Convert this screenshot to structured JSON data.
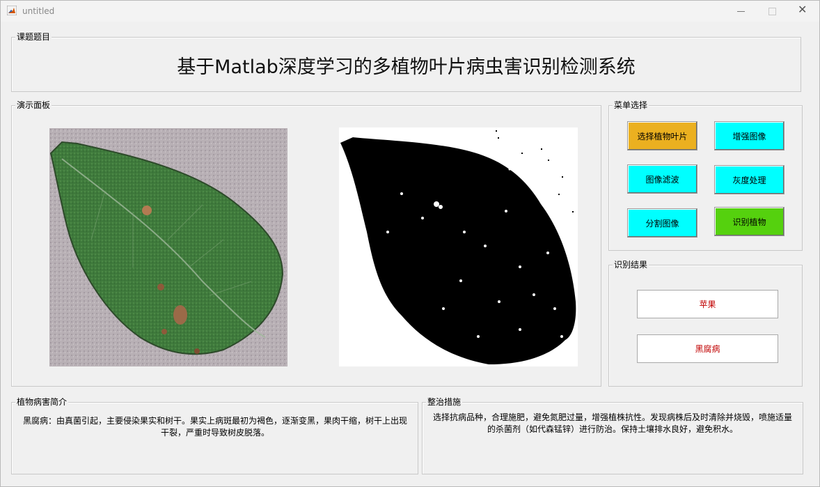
{
  "window": {
    "title": "untitled",
    "close_glyph": "✕"
  },
  "title_panel": {
    "label": "课题题目",
    "title": "基于Matlab深度学习的多植物叶片病虫害识别检测系统"
  },
  "demo_panel": {
    "label": "演示面板"
  },
  "menu_panel": {
    "label": "菜单选择",
    "buttons": [
      {
        "label": "选择植物叶片",
        "color": "#ebb020"
      },
      {
        "label": "增强图像",
        "color": "#00ffff"
      },
      {
        "label": "图像滤波",
        "color": "#00ffff"
      },
      {
        "label": "灰度处理",
        "color": "#00ffff"
      },
      {
        "label": "分割图像",
        "color": "#00ffff"
      },
      {
        "label": "识别植物",
        "color": "#55d10e"
      }
    ]
  },
  "result_panel": {
    "label": "识别结果",
    "plant": "苹果",
    "disease": "黑腐病",
    "text_color": "#c00000"
  },
  "intro_panel": {
    "label": "植物病害简介",
    "text": "黑腐病：由真菌引起，主要侵染果实和树干。果实上病斑最初为褐色，逐渐变黑，果肉干缩，树干上出现干裂，严重时导致树皮脱落。"
  },
  "measures_panel": {
    "label": "整治措施",
    "text": "选择抗病品种，合理施肥，避免氮肥过量，增强植株抗性。发现病株后及时清除并烧毁，喷施适量的杀菌剂（如代森锰锌）进行防治。保持土壤排水良好，避免积水。"
  }
}
